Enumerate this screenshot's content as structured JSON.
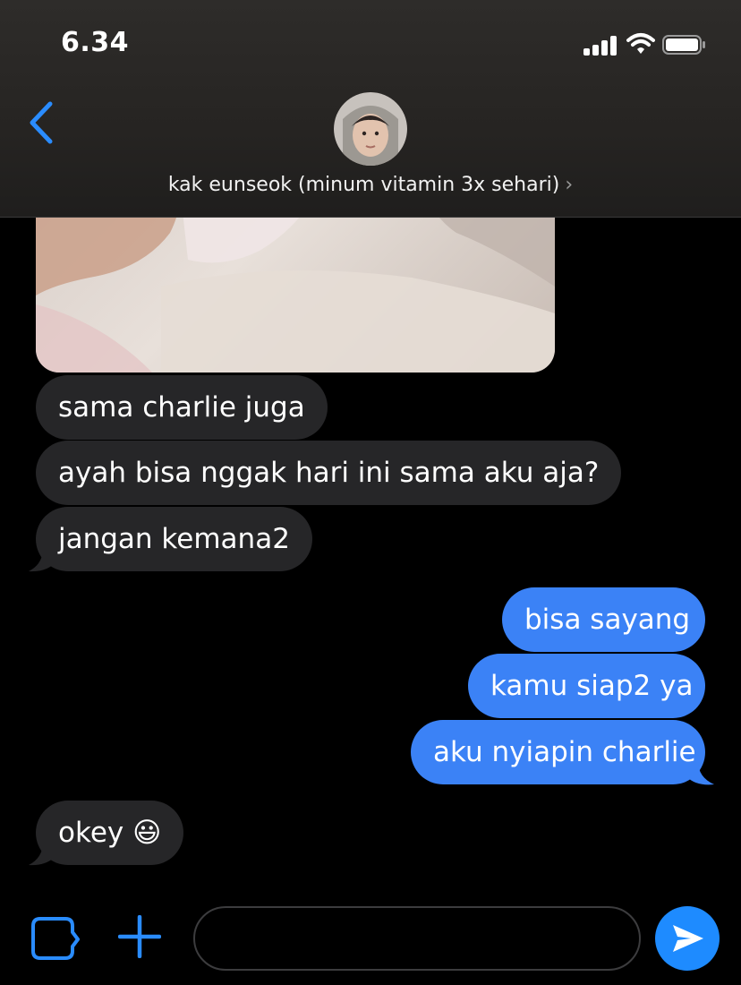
{
  "status_bar": {
    "time": "6.34"
  },
  "header": {
    "contact_name": "kak eunseok (minum vitamin 3x sehari)",
    "chevron": "›"
  },
  "messages": [
    {
      "direction": "received",
      "text": "sama charlie juga"
    },
    {
      "direction": "received",
      "text": "ayah bisa nggak hari ini sama aku aja?"
    },
    {
      "direction": "received",
      "text": "jangan kemana2"
    },
    {
      "direction": "sent",
      "text": "bisa sayang"
    },
    {
      "direction": "sent",
      "text": "kamu siap2 ya"
    },
    {
      "direction": "sent",
      "text": "aku nyiapin charlie"
    },
    {
      "direction": "received",
      "text": "okey 😃"
    }
  ],
  "composer": {
    "value": "",
    "placeholder": ""
  },
  "colors": {
    "sent_bubble": "#3b82f6",
    "received_bubble": "#262628",
    "accent": "#1e8bff"
  },
  "icons": [
    "chevron-left-icon",
    "camera-icon",
    "plus-icon",
    "send-icon",
    "signal-icon",
    "wifi-icon",
    "battery-icon"
  ]
}
